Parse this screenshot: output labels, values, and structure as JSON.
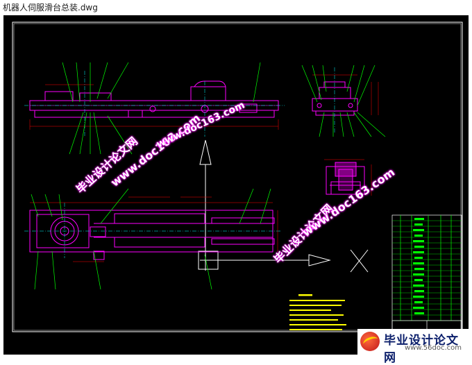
{
  "window": {
    "title": "机器人伺服滑台总装.dwg"
  },
  "watermarks": [
    {
      "cn": "毕业设计论文网",
      "url": "www.doc163.com"
    },
    {
      "cn": "毕业设计论文网",
      "url": "www.doc163.com"
    },
    {
      "cn": "毕业设计论文网",
      "url": "www.doc163.com"
    }
  ],
  "footer_logo": {
    "name": "毕业设计论文网",
    "url": "www.56doc.com"
  },
  "colors": {
    "background": "#000000",
    "outline": "#ff00ff",
    "leader": "#00ff00",
    "frame": "#ffffff",
    "dims": "#ff0000"
  }
}
